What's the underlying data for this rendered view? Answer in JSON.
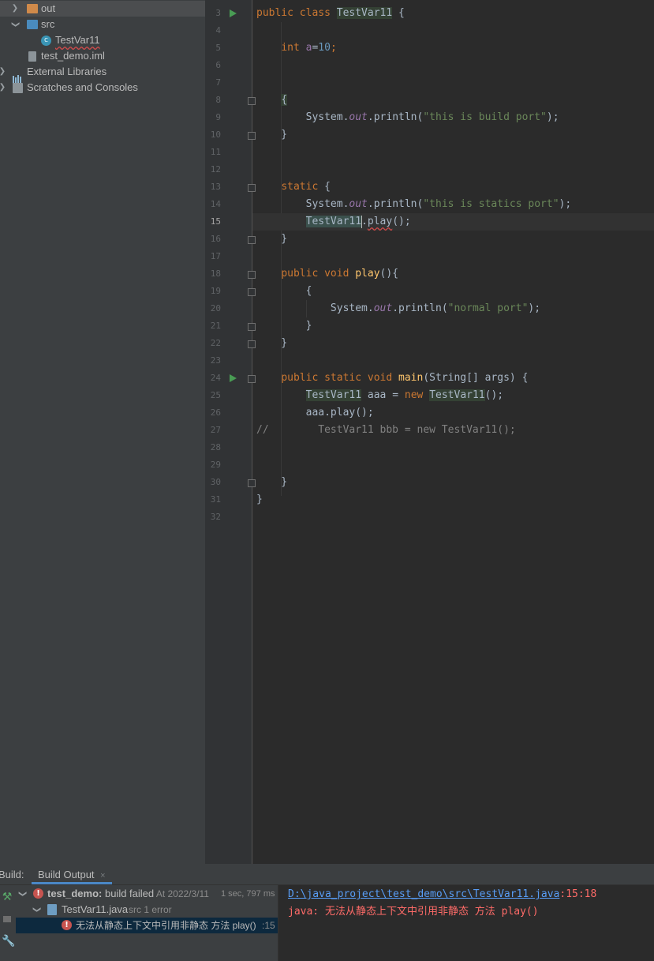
{
  "project_tree": {
    "items": [
      {
        "label": "out",
        "icon": "folder-icon"
      },
      {
        "label": "src",
        "icon": "source-folder-icon"
      },
      {
        "label": "TestVar11",
        "icon": "java-class-icon"
      },
      {
        "label": "test_demo.iml",
        "icon": "module-file-icon"
      },
      {
        "label": "External Libraries",
        "icon": "libraries-icon"
      },
      {
        "label": "Scratches and Consoles",
        "icon": "scratches-icon"
      }
    ]
  },
  "editor": {
    "line_numbers": [
      "3",
      "4",
      "5",
      "6",
      "7",
      "8",
      "9",
      "10",
      "11",
      "12",
      "13",
      "14",
      "15",
      "16",
      "17",
      "18",
      "19",
      "20",
      "21",
      "22",
      "23",
      "24",
      "25",
      "26",
      "27",
      "28",
      "29",
      "30",
      "31",
      "32"
    ],
    "current_line": "15",
    "code": {
      "l3": {
        "t1": "public class ",
        "t2": "TestVar11",
        "t3": " {"
      },
      "l5": {
        "t1": "    ",
        "t2": "int ",
        "t3": "a",
        "t4": "=",
        "t5": "10",
        "t6": ";"
      },
      "l8": {
        "t1": "    ",
        "t2": "{"
      },
      "l9": {
        "t1": "        System.",
        "t2": "out",
        "t3": ".println(",
        "t4": "\"this is build port\"",
        "t5": ");"
      },
      "l10": {
        "t1": "    }"
      },
      "l13": {
        "t1": "    ",
        "t2": "static",
        "t3": " {"
      },
      "l14": {
        "t1": "        System.",
        "t2": "out",
        "t3": ".println(",
        "t4": "\"this is statics port\"",
        "t5": ");"
      },
      "l15": {
        "t1": "        ",
        "t2": "TestVar11",
        "t3": ".",
        "t4": "play",
        "t5": "();"
      },
      "l16": {
        "t1": "    }"
      },
      "l18": {
        "t1": "    ",
        "t2": "public void ",
        "t3": "play",
        "t4": "(){"
      },
      "l19": {
        "t1": "        {"
      },
      "l20": {
        "t1": "            System.",
        "t2": "out",
        "t3": ".println(",
        "t4": "\"normal port\"",
        "t5": ");"
      },
      "l21": {
        "t1": "        }"
      },
      "l22": {
        "t1": "    }"
      },
      "l24": {
        "t1": "    ",
        "t2": "public static void ",
        "t3": "main",
        "t4": "(String[] args) {"
      },
      "l25": {
        "t1": "        ",
        "t2": "TestVar11",
        "t3": " aaa = ",
        "t4": "new ",
        "t5": "TestVar11",
        "t6": "();"
      },
      "l26": {
        "t1": "        aaa.play();"
      },
      "l27": {
        "t1": "//        TestVar11 bbb = new TestVar11();"
      },
      "l30": {
        "t1": "    }"
      },
      "l31": {
        "t1": "}"
      }
    }
  },
  "build": {
    "title": "Build:",
    "tab_label": "Build Output",
    "tab_close": "×",
    "tree": {
      "root": {
        "name": "test_demo:",
        "status": " build failed",
        "at": " At 2022/3/11",
        "duration": "1 sec, 797 ms"
      },
      "file": {
        "name": "TestVar11.java",
        "info": " src 1 error"
      },
      "error": {
        "message": "无法从静态上下文中引用非静态 方法 play()",
        "line": ":15"
      }
    },
    "console": {
      "path": "D:\\java_project\\test_demo\\src\\TestVar11.java",
      "position": ":15:18",
      "error": "java: 无法从静态上下文中引用非静态 方法 play()"
    }
  },
  "colors": {
    "keyword": "#cc7832",
    "string": "#6a8759",
    "number": "#6897bb",
    "field": "#9876aa",
    "method": "#ffc66d",
    "error": "#ff6b68",
    "link": "#589df6"
  }
}
